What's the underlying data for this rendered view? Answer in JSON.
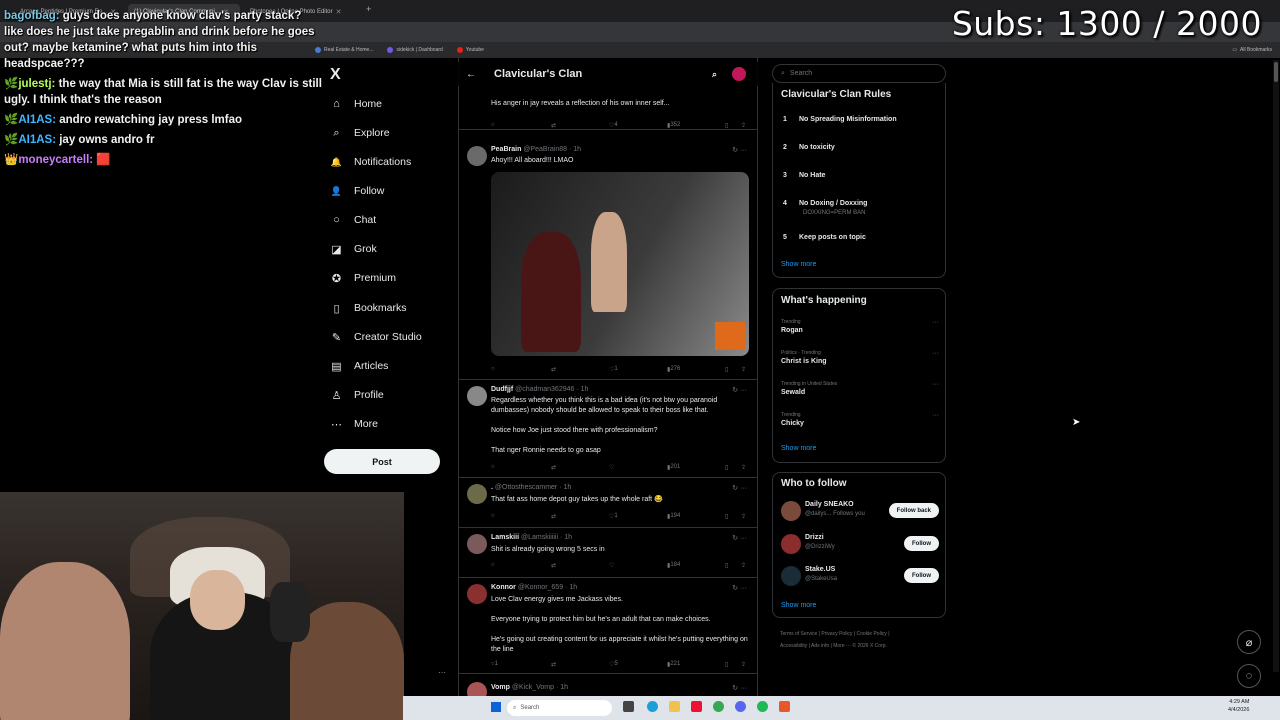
{
  "browser": {
    "tabs": [
      {
        "title": "Arcane Peptides | Premium Re..."
      },
      {
        "title": "(1) Clavicular's Clan Communi..."
      },
      {
        "title": "Photopea | Online Photo Editor"
      }
    ],
    "bookmarks": [
      "Real Estate & Home...",
      "sidekick | Dashboard",
      "Youtube"
    ],
    "bookmarks_right": "All Bookmarks"
  },
  "overlay": {
    "subs": "Subs: 1300 / 2000",
    "chat": [
      {
        "user": "bagofbag:",
        "text": "guys does anyone know clav's party stack? like does he just take pregablin and drink before he goes out? maybe ketamine? what puts him into this headspcae???",
        "color": "#7ec8e3"
      },
      {
        "user": "julestj:",
        "text": "the way that Mia is still fat is the way Clav is still ugly. I think that's the reason",
        "color": "#b6ff57"
      },
      {
        "user": "AI1AS:",
        "text": "andro rewatching jay press lmfao",
        "color": "#3fb6ff"
      },
      {
        "user": "AI1AS:",
        "text": "jay owns andro fr",
        "color": "#3fb6ff"
      },
      {
        "user": "moneycartell:",
        "text": "",
        "color": "#c77dff"
      }
    ]
  },
  "nav": {
    "logo": "X",
    "items": [
      {
        "label": "Home",
        "icon": "home-icon",
        "glyph": "⌂"
      },
      {
        "label": "Explore",
        "icon": "search-icon",
        "glyph": "⌕"
      },
      {
        "label": "Notifications",
        "icon": "bell-icon",
        "glyph": "🔔"
      },
      {
        "label": "Follow",
        "icon": "person-plus-icon",
        "glyph": "👤"
      },
      {
        "label": "Chat",
        "icon": "chat-icon",
        "glyph": "○"
      },
      {
        "label": "Grok",
        "icon": "grok-icon",
        "glyph": "◪"
      },
      {
        "label": "Premium",
        "icon": "premium-icon",
        "glyph": "✪"
      },
      {
        "label": "Bookmarks",
        "icon": "bookmark-icon",
        "glyph": "▯"
      },
      {
        "label": "Creator Studio",
        "icon": "creator-icon",
        "glyph": "✎"
      },
      {
        "label": "Articles",
        "icon": "articles-icon",
        "glyph": "▤"
      },
      {
        "label": "Profile",
        "icon": "profile-icon",
        "glyph": "♙"
      },
      {
        "label": "More",
        "icon": "more-icon",
        "glyph": "⋯"
      }
    ],
    "post_label": "Post"
  },
  "feed": {
    "title": "Clavicular's Clan",
    "top_snippet": "His anger in jay reveals a reflection of his own inner self...",
    "top_actions": {
      "likes": "4",
      "views": "352"
    },
    "posts": [
      {
        "name": "PeaBrain",
        "handle": "@PeaBrain88 · 1h",
        "text": "Ahoy!!! All aboard!!! LMAO",
        "likes": "1",
        "views": "276"
      },
      {
        "name": "Dudfjjf",
        "handle": "@chadman362946 · 1h",
        "text": "Regardless whether you think this is a bad idea (it's not btw you paranoid dumbasses) nobody should be allowed to speak to their boss like that.",
        "text2": "Notice how Joe just stood there with professionalism?",
        "text3": "That nger Ronnie needs to go asap",
        "views": "201"
      },
      {
        "name": ".",
        "handle": "@Ottosthescammer · 1h",
        "text": "That fat ass home depot guy takes up the whole raft 😂",
        "likes": "1",
        "views": "194"
      },
      {
        "name": "Lamskiii",
        "handle": "@Lamskiiiiii · 1h",
        "text": "Shit is already going wrong 5 secs in",
        "views": "184"
      },
      {
        "name": "Konnor",
        "handle": "@Konnor_659 · 1h",
        "text": "Love Clav energy gives me Jackass vibes.",
        "text2": "Everyone trying to protect him but he's an adult that can make choices.",
        "text3": "He's going out creating content for us appreciate it whilst he's putting everything on the line",
        "replies": "1",
        "likes": "5",
        "views": "221"
      },
      {
        "name": "Vomp",
        "handle": "@Kick_Vomp · 1h"
      }
    ]
  },
  "sidebar": {
    "search_placeholder": "Search",
    "rules_title": "Clavicular's Clan Rules",
    "rules": [
      {
        "n": "1",
        "text": "No Spreading Misinformation"
      },
      {
        "n": "2",
        "text": "No toxicity"
      },
      {
        "n": "3",
        "text": "No Hate"
      },
      {
        "n": "4",
        "text": "No Doxing / Doxxing",
        "sub": "DOXXING=PERM BAN"
      },
      {
        "n": "5",
        "text": "Keep posts on topic"
      }
    ],
    "show_more": "Show more",
    "happening_title": "What's happening",
    "trends": [
      {
        "cat": "Trending",
        "name": "Rogan"
      },
      {
        "cat": "Politics · Trending",
        "name": "Christ is King"
      },
      {
        "cat": "Trending in United States",
        "name": "Sewald"
      },
      {
        "cat": "Trending",
        "name": "Chicky"
      }
    ],
    "wtf_title": "Who to follow",
    "follows": [
      {
        "name": "Daily SNEAKO",
        "handle": "@dailys...  Follows you",
        "button": "Follow back",
        "color": "#7a4b3a"
      },
      {
        "name": "Drizzi",
        "handle": "@DrizziWy",
        "button": "Follow",
        "color": "#8b2d2d"
      },
      {
        "name": "Stake.US",
        "handle": "@StakeUsa",
        "button": "Follow",
        "color": "#1a2c38"
      }
    ],
    "footer": [
      "Terms of Service",
      "Privacy Policy",
      "Cookie Policy",
      "Accessibility",
      "Ads info",
      "More ···",
      "© 2026 X Corp."
    ]
  },
  "taskbar": {
    "search": "Search",
    "time": "4:29 AM",
    "date": "4/4/2026"
  }
}
